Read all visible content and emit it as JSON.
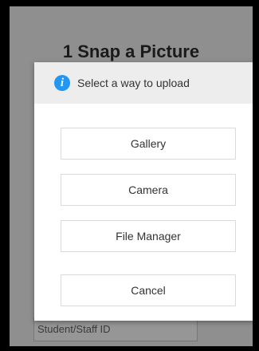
{
  "background_page": {
    "heading": "1 Snap a Picture",
    "id_field_placeholder": "Student/Staff ID"
  },
  "dialog": {
    "icon": "info-icon",
    "title": "Select a way to upload",
    "options": {
      "gallery": "Gallery",
      "camera": "Camera",
      "file_manager": "File Manager"
    },
    "cancel_label": "Cancel"
  },
  "colors": {
    "overlay": "#8f8f8f",
    "dialog_header": "#ededed",
    "info_icon": "#2196f3"
  }
}
